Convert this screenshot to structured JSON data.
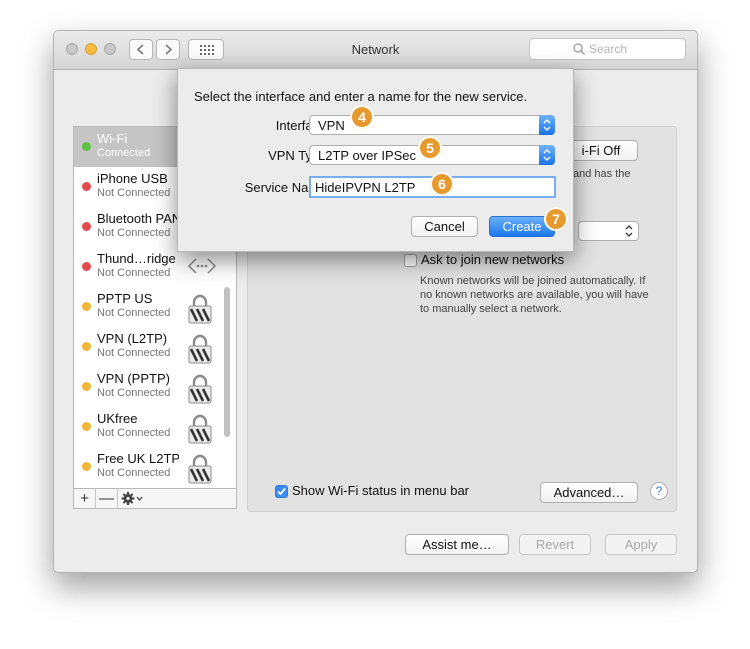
{
  "window": {
    "title": "Network",
    "search_placeholder": "Search",
    "colors": {
      "close": "#fc605c",
      "minimize": "#fdbc40",
      "zoom": "#c8c8c8"
    }
  },
  "sidebar": {
    "items": [
      {
        "name": "Wi-Fi",
        "status": "Connected",
        "color": "#5ec144",
        "icon": "",
        "selected": true
      },
      {
        "name": "iPhone USB",
        "status": "Not Connected",
        "color": "#e34b4b",
        "icon": ""
      },
      {
        "name": "Bluetooth PAN",
        "status": "Not Connected",
        "color": "#e34b4b",
        "icon": ""
      },
      {
        "name": "Thund…ridge",
        "status": "Not Connected",
        "color": "#e34b4b",
        "icon": "ethernet-icon"
      },
      {
        "name": "PPTP US",
        "status": "Not Connected",
        "color": "#f2b534",
        "icon": "vpn-lock-icon"
      },
      {
        "name": "VPN (L2TP)",
        "status": "Not Connected",
        "color": "#f2b534",
        "icon": "vpn-lock-icon"
      },
      {
        "name": "VPN (PPTP)",
        "status": "Not Connected",
        "color": "#f2b534",
        "icon": "vpn-lock-icon"
      },
      {
        "name": "UKfree",
        "status": "Not Connected",
        "color": "#f2b534",
        "icon": "vpn-lock-icon"
      },
      {
        "name": "Free UK L2TP",
        "status": "Not Connected",
        "color": "#f2b534",
        "icon": "vpn-lock-icon"
      }
    ],
    "buttons": {
      "add": "+",
      "remove": "—"
    }
  },
  "detail": {
    "turn_off_label": "i-Fi Off",
    "partial_text": "and has the",
    "ask_join_label": "Ask to join new networks",
    "ask_join_checked": false,
    "ask_join_help": [
      "Known networks will be joined automatically. If",
      "no known networks are available, you will have",
      "to manually select a network."
    ],
    "show_status_label": "Show Wi-Fi status in menu bar",
    "show_status_checked": true,
    "advanced_label": "Advanced…",
    "help_label": "?"
  },
  "footer": {
    "assist_label": "Assist me…",
    "revert_label": "Revert",
    "apply_label": "Apply"
  },
  "dialog": {
    "title": "Select the interface and enter a name for the new service.",
    "interface_label": "Interface:",
    "interface_value": "VPN",
    "vpn_type_label": "VPN Type:",
    "vpn_type_value": "L2TP over IPSec",
    "service_name_label": "Service Name:",
    "service_name_value": "HideIPVPN L2TP",
    "cancel_label": "Cancel",
    "create_label": "Create"
  },
  "annotations": {
    "step4": "4",
    "step5": "5",
    "step6": "6",
    "step7": "7",
    "color": "#e69a2e"
  }
}
